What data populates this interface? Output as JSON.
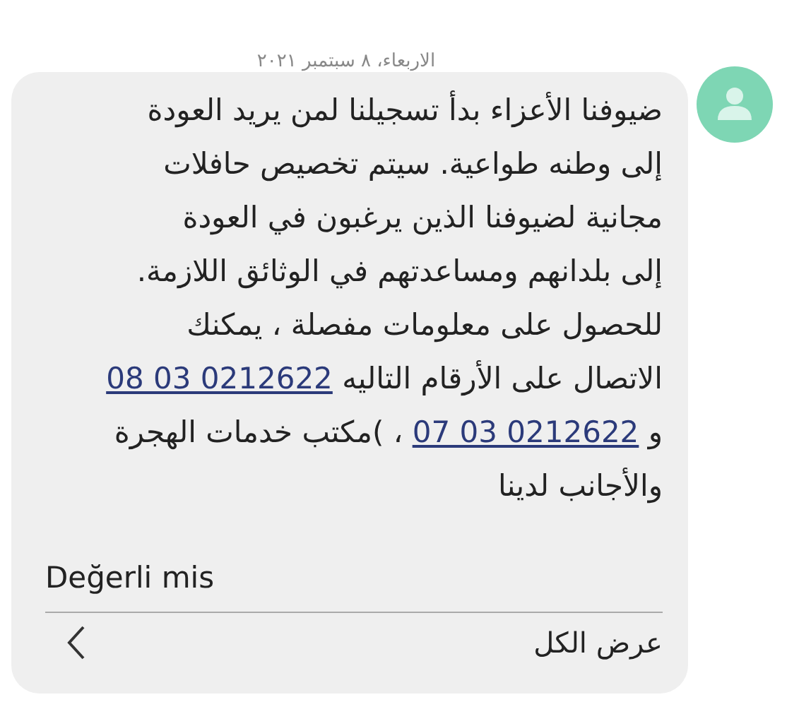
{
  "date": "الاربعاء، ٨ سبتمبر ٢٠٢١",
  "message": {
    "lines": [
      [
        {
          "kind": "text",
          "text": "ضيوفنا الأعزاء بدأ تسجيلنا لمن يريد العودة"
        }
      ],
      [
        {
          "kind": "text",
          "text": "إلى وطنه طواعية.  سيتم تخصيص حافلات"
        }
      ],
      [
        {
          "kind": "text",
          "text": "مجانية لضيوفنا الذين يرغبون في العودة"
        }
      ],
      [
        {
          "kind": "text",
          "text": "إلى بلدانهم ومساعدتهم في الوثائق اللازمة."
        }
      ],
      [
        {
          "kind": "text",
          "text": "للحصول على معلومات مفصلة ، يمكنك"
        }
      ],
      [
        {
          "kind": "text",
          "text": "الاتصال على الأرقام التاليه "
        },
        {
          "kind": "link",
          "text": "08 03 0212622"
        }
      ],
      [
        {
          "kind": "text",
          "text": "و "
        },
        {
          "kind": "link",
          "text": "07 03 0212622"
        },
        {
          "kind": "text",
          "text": " ، )مكتب خدمات الهجرة"
        }
      ],
      [
        {
          "kind": "text",
          "text": "والأجانب لدينا"
        }
      ]
    ]
  },
  "signature": "Değerli mis",
  "view_all": "عرض الكل"
}
